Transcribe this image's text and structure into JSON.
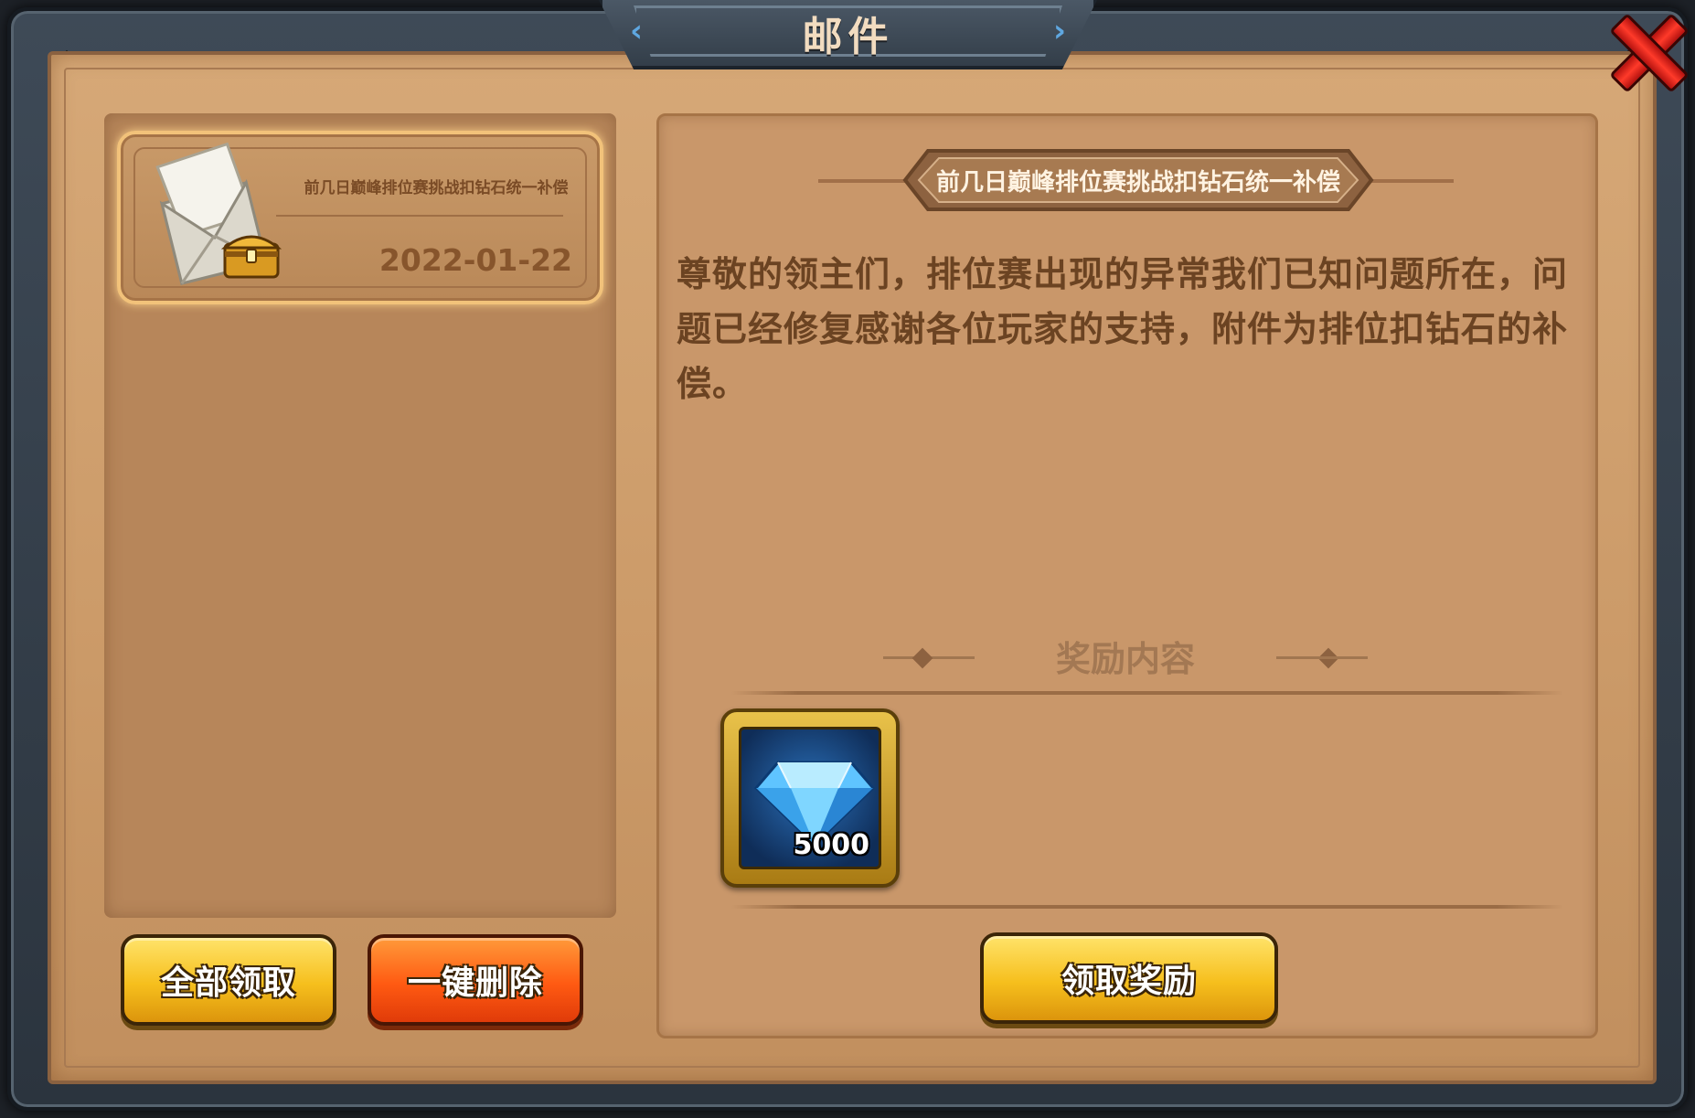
{
  "window": {
    "title": "邮件"
  },
  "mail_list": {
    "items": [
      {
        "subject": "前几日巅峰排位赛挑战扣钻石统一补偿",
        "date": "2022-01-22",
        "icon": "envelope-with-chest-icon",
        "selected": true
      }
    ]
  },
  "buttons": {
    "claim_all": "全部领取",
    "delete_all": "一键删除",
    "claim_reward": "领取奖励",
    "close": "close-icon"
  },
  "detail": {
    "subject": "前几日巅峰排位赛挑战扣钻石统一补偿",
    "body": "尊敬的领主们，排位赛出现的异常我们已知问题所在，问题已经修复感谢各位玩家的支持，附件为排位扣钻石的补偿。",
    "rewards_title": "奖励内容",
    "rewards": [
      {
        "icon": "diamond-icon",
        "count": "5000"
      }
    ]
  },
  "colors": {
    "parchment": "#cc9b69",
    "frame": "#3e4a57",
    "text_brown": "#6b4322",
    "button_yellow": "#f6bf1d",
    "button_orange": "#ff5a12",
    "close_red": "#e0241a"
  }
}
